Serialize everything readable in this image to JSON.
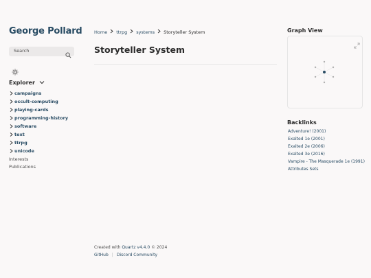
{
  "site": {
    "title": "George Pollard"
  },
  "search": {
    "placeholder": "Search"
  },
  "explorer": {
    "title": "Explorer",
    "folders": [
      {
        "label": "campaigns"
      },
      {
        "label": "occult-computing"
      },
      {
        "label": "playing-cards"
      },
      {
        "label": "programming-history"
      },
      {
        "label": "software"
      },
      {
        "label": "text"
      },
      {
        "label": "ttrpg"
      },
      {
        "label": "unicode"
      }
    ],
    "files": [
      {
        "label": "Interests"
      },
      {
        "label": "Publications"
      }
    ]
  },
  "breadcrumb": {
    "items": [
      "Home",
      "ttrpg",
      "systems"
    ],
    "current": "Storyteller System"
  },
  "page": {
    "title": "Storyteller System"
  },
  "footer": {
    "created_prefix": "Created with",
    "quartz_link": "Quartz v4.4.0",
    "created_suffix": "© 2024",
    "links": [
      "GitHub",
      "Discord Community"
    ]
  },
  "graph": {
    "title": "Graph View"
  },
  "backlinks": {
    "title": "Backlinks",
    "items": [
      "Adventure! (2001)",
      "Exalted 1e (2001)",
      "Exalted 2e (2006)",
      "Exalted 3e (2016)",
      "Vampire - The Masquerade 1e (1991)",
      "Attributes Sets"
    ]
  },
  "colors": {
    "background": "#faf8f8",
    "accent": "#284b63",
    "text": "#2b2b2b",
    "muted": "#4e4e4e",
    "node": "#b0b0b0",
    "current_node": "#284b63"
  }
}
